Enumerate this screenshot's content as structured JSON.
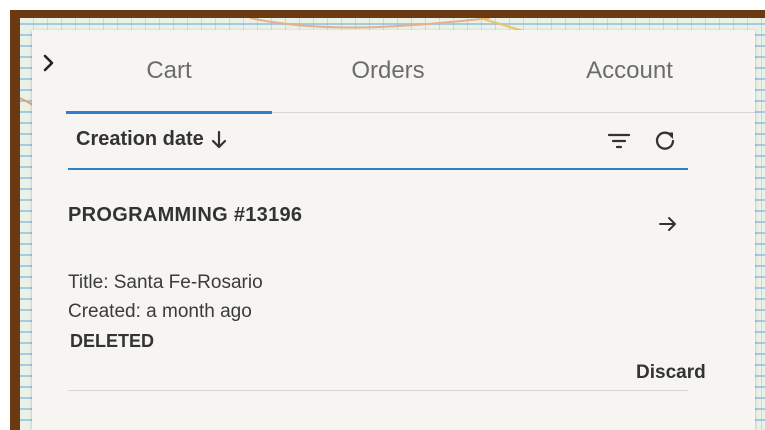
{
  "tabs": [
    {
      "label": "Cart"
    },
    {
      "label": "Orders"
    },
    {
      "label": "Account"
    }
  ],
  "active_tab": "Cart",
  "sort": {
    "label": "Creation date",
    "direction_icon": "arrow-down-icon"
  },
  "toolbar_icons": {
    "filter": "filter-icon",
    "refresh": "refresh-icon",
    "collapse": "chevron-right-icon"
  },
  "order": {
    "title": "PROGRAMMING #13196",
    "title_line": "Title: Santa Fe-Rosario",
    "created_line": "Created: a month ago",
    "status": "DELETED",
    "discard_label": "Discard",
    "open_icon": "arrow-right-icon"
  },
  "colors": {
    "accent": "#2f7fd0",
    "frame": "#6b3a12",
    "panel": "#f7f5f2"
  }
}
